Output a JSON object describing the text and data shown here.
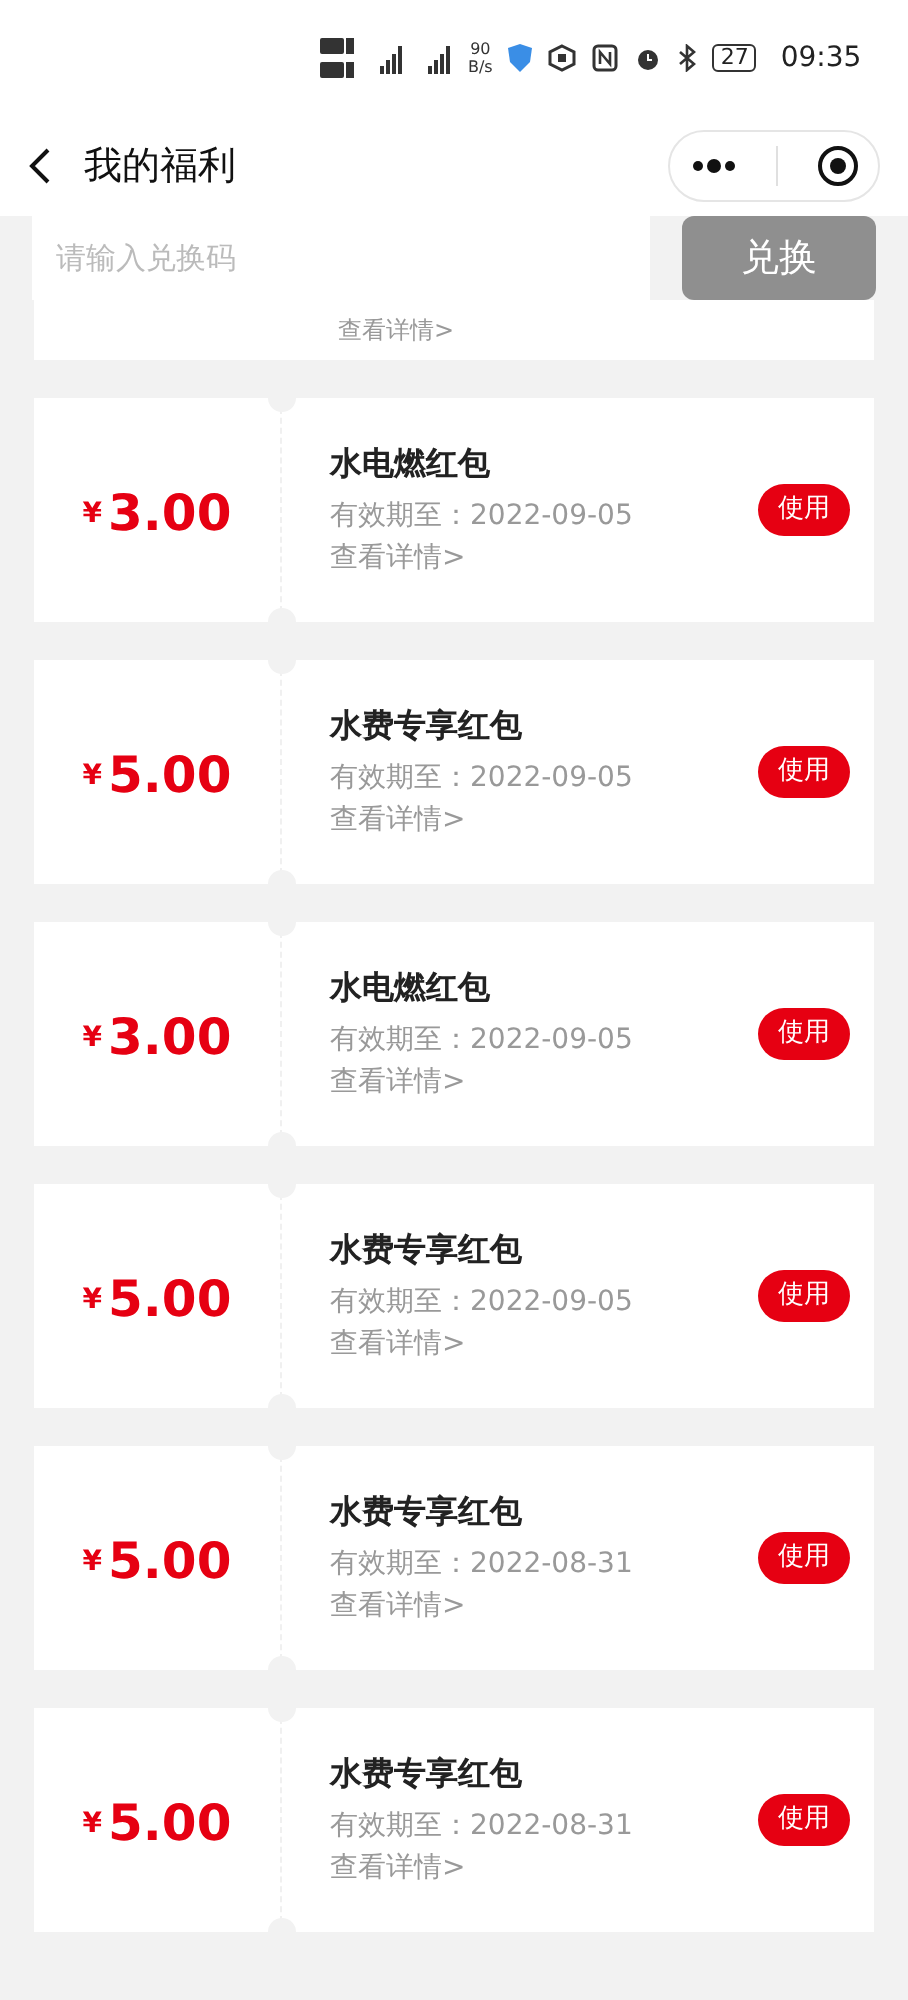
{
  "status_bar": {
    "speed_value": "90",
    "speed_unit": "B/s",
    "battery": "27",
    "time": "09:35"
  },
  "header": {
    "title": "我的福利"
  },
  "redeem": {
    "placeholder": "请输入兑换码",
    "button": "兑换",
    "disabled": true
  },
  "partial_card": {
    "details": "查看详情>"
  },
  "coupons": [
    {
      "currency": "¥",
      "amount": "3.00",
      "title": "水电燃红包",
      "expiry": "有效期至：2022-09-05",
      "details": "查看详情>",
      "action": "使用"
    },
    {
      "currency": "¥",
      "amount": "5.00",
      "title": "水费专享红包",
      "expiry": "有效期至：2022-09-05",
      "details": "查看详情>",
      "action": "使用"
    },
    {
      "currency": "¥",
      "amount": "3.00",
      "title": "水电燃红包",
      "expiry": "有效期至：2022-09-05",
      "details": "查看详情>",
      "action": "使用"
    },
    {
      "currency": "¥",
      "amount": "5.00",
      "title": "水费专享红包",
      "expiry": "有效期至：2022-09-05",
      "details": "查看详情>",
      "action": "使用"
    },
    {
      "currency": "¥",
      "amount": "5.00",
      "title": "水费专享红包",
      "expiry": "有效期至：2022-08-31",
      "details": "查看详情>",
      "action": "使用"
    },
    {
      "currency": "¥",
      "amount": "5.00",
      "title": "水费专享红包",
      "expiry": "有效期至：2022-08-31",
      "details": "查看详情>",
      "action": "使用"
    }
  ]
}
